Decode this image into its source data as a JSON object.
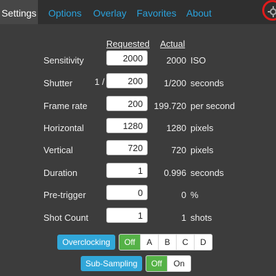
{
  "tabs": {
    "settings": "Settings",
    "options": "Options",
    "overlay": "Overlay",
    "favorites": "Favorites",
    "about": "About"
  },
  "columns": {
    "requested": "Requested",
    "actual": "Actual"
  },
  "rows": {
    "sensitivity": {
      "label": "Sensitivity",
      "value": "2000",
      "actual": "2000",
      "unit": "ISO"
    },
    "shutter": {
      "label": "Shutter",
      "prefix": "1 /",
      "value": "200",
      "actual": "1/200",
      "unit": "seconds"
    },
    "frame_rate": {
      "label": "Frame rate",
      "value": "200",
      "actual": "199.720",
      "unit": "per second"
    },
    "horizontal": {
      "label": "Horizontal",
      "value": "1280",
      "actual": "1280",
      "unit": "pixels"
    },
    "vertical": {
      "label": "Vertical",
      "value": "720",
      "actual": "720",
      "unit": "pixels"
    },
    "duration": {
      "label": "Duration",
      "value": "1",
      "actual": "0.996",
      "unit": "seconds"
    },
    "pre_trigger": {
      "label": "Pre-trigger",
      "value": "0",
      "actual": "0",
      "unit": "%"
    },
    "shot_count": {
      "label": "Shot Count",
      "value": "1",
      "actual": "1",
      "unit": "shots"
    }
  },
  "overclocking": {
    "label": "Overclocking",
    "options": [
      "Off",
      "A",
      "B",
      "C",
      "D"
    ],
    "selected": "Off"
  },
  "subsampling": {
    "label": "Sub-Sampling",
    "options": [
      "Off",
      "On"
    ],
    "selected": "Off"
  },
  "colors": {
    "accent": "#2aa2dc",
    "toggle_on": "#55b247",
    "background": "#3c3c3c",
    "highlight": "#e11b1b"
  },
  "icons": {
    "top_right": "gear-icon"
  }
}
